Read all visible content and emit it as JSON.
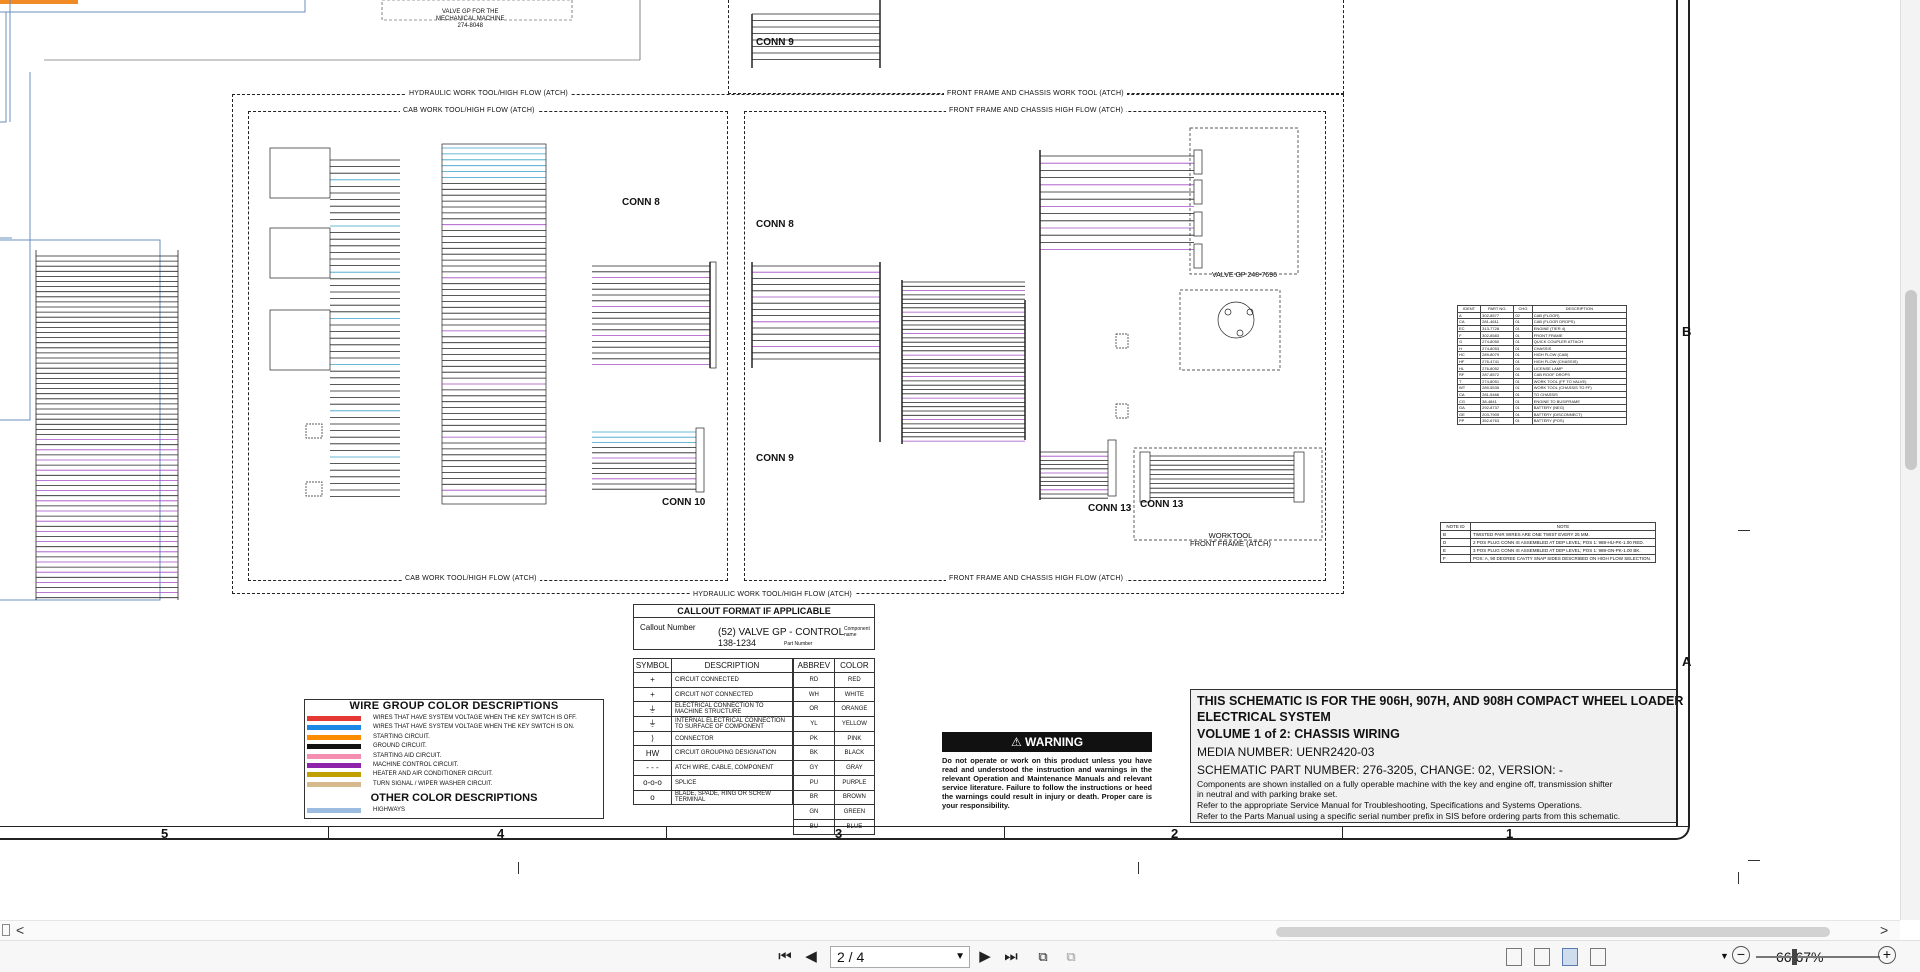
{
  "document": {
    "frames": {
      "hydraulic_top_left": "HYDRAULIC WORK TOOL/HIGH FLOW (ATCH)",
      "front_frame_work_tool": "FRONT FRAME AND CHASSIS WORK TOOL (ATCH)",
      "cab_work_tool_top": "CAB WORK TOOL/HIGH FLOW (ATCH)",
      "front_frame_high_flow_top": "FRONT FRAME AND CHASSIS HIGH FLOW (ATCH)",
      "cab_work_tool_bottom": "CAB WORK TOOL/HIGH FLOW (ATCH)",
      "front_frame_high_flow_bottom": "FRONT FRAME AND CHASSIS HIGH FLOW (ATCH)",
      "hydraulic_bottom": "HYDRAULIC WORK TOOL/HIGH FLOW (ATCH)"
    },
    "valve_top": "VALVE GP FOR THE\nMECHANICAL MACHINE\n274-8048",
    "valve_gp": "VALVE GP 248-7696",
    "connectors": {
      "conn9_top": "CONN 9",
      "conn8_left": "CONN 8",
      "conn8_right": "CONN 8",
      "conn9_bottom": "CONN 9",
      "conn10": "CONN 10",
      "conn13_a": "CONN 13",
      "conn13_b": "CONN 13"
    },
    "worktool_label": "WORKTOOL\nFRONT FRAME (ATCH)",
    "callout": {
      "title": "CALLOUT FORMAT IF APPLICABLE",
      "number_label": "Callout Number",
      "main": "(52) VALVE GP - CONTROL",
      "part_number": "138-1234",
      "component_name": "Component\nname",
      "part_number_label": "Part Number"
    },
    "symbol_table": {
      "headers": [
        "SYMBOL",
        "DESCRIPTION"
      ],
      "rows": [
        {
          "symbol": "+",
          "description": "CIRCUIT CONNECTED"
        },
        {
          "symbol": "+",
          "description": "CIRCUIT NOT CONNECTED"
        },
        {
          "symbol": "⏚",
          "description": "ELECTRICAL CONNECTION TO MACHINE STRUCTURE"
        },
        {
          "symbol": "⏚",
          "description": "INTERNAL ELECTRICAL CONNECTION TO SURFACE OF COMPONENT"
        },
        {
          "symbol": "⟩",
          "description": "CONNECTOR"
        },
        {
          "symbol": "HW",
          "description": "CIRCUIT GROUPING DESIGNATION"
        },
        {
          "symbol": "- - -",
          "description": "ATCH WIRE, CABLE, COMPONENT"
        },
        {
          "symbol": "o-o-o",
          "description": "SPLICE"
        },
        {
          "symbol": "o",
          "description": "BLADE, SPADE, RING OR SCREW TERMINAL"
        }
      ]
    },
    "color_table": {
      "headers": [
        "ABBREV",
        "COLOR"
      ],
      "rows": [
        [
          "RD",
          "RED"
        ],
        [
          "WH",
          "WHITE"
        ],
        [
          "OR",
          "ORANGE"
        ],
        [
          "YL",
          "YELLOW"
        ],
        [
          "PK",
          "PINK"
        ],
        [
          "BK",
          "BLACK"
        ],
        [
          "GY",
          "GRAY"
        ],
        [
          "PU",
          "PURPLE"
        ],
        [
          "BR",
          "BROWN"
        ],
        [
          "GN",
          "GREEN"
        ],
        [
          "BU",
          "BLUE"
        ]
      ]
    },
    "wire_group": {
      "title": "WIRE GROUP COLOR DESCRIPTIONS",
      "rows": [
        {
          "color": "#e53935",
          "text": "WIRES THAT HAVE SYSTEM VOLTAGE WHEN THE KEY SWITCH IS OFF."
        },
        {
          "color": "#1e88e5",
          "text": "WIRES THAT HAVE SYSTEM VOLTAGE WHEN THE KEY SWITCH IS ON."
        },
        {
          "color": "#fb8c00",
          "text": "STARTING CIRCUIT."
        },
        {
          "color": "#111111",
          "text": "GROUND CIRCUIT."
        },
        {
          "color": "#f48fb1",
          "text": "STARTING AID CIRCUIT."
        },
        {
          "color": "#8e24aa",
          "text": "MACHINE CONTROL CIRCUIT."
        },
        {
          "color": "#c0a000",
          "text": "HEATER AND AIR CONDITIONER CIRCUIT."
        },
        {
          "color": "#d7b98e",
          "text": "TURN SIGNAL / WIPER WASHER CIRCUIT."
        }
      ],
      "other_title": "OTHER COLOR DESCRIPTIONS",
      "other_rows": [
        {
          "color": "#9bbbe0",
          "text": "HIGHWAYS"
        }
      ]
    },
    "warning": {
      "title": "WARNING",
      "body": "Do not operate or work on this product unless you have read and understood the instruction and warnings in the relevant Operation and Maintenance Manuals and relevant service literature. Failure to follow the instructions or heed the warnings could result in injury or death. Proper care is your responsibility."
    },
    "title_block": {
      "line1": "THIS SCHEMATIC IS FOR THE 906H, 907H, AND 908H COMPACT WHEEL LOADER",
      "line2": "ELECTRICAL SYSTEM",
      "line3": "VOLUME 1 of 2: CHASSIS WIRING",
      "line4": "MEDIA NUMBER: UENR2420-03",
      "line5": "SCHEMATIC PART NUMBER: 276-3205, CHANGE: 02, VERSION: -",
      "line6": "Components are shown installed on a fully operable machine with the key and engine off, transmission shifter",
      "line7": "in neutral and with parking brake set.",
      "line8": "Refer to the appropriate Service Manual for Troubleshooting, Specifications and Systems Operations.",
      "line9": "Refer to the Parts Manual using a specific serial number prefix in SIS before ordering parts from this schematic."
    },
    "grid_columns": [
      "5",
      "4",
      "3",
      "2",
      "1"
    ],
    "grid_rows": [
      "B",
      "A"
    ],
    "parts_table": {
      "headers": [
        "IDENT",
        "PART NO.",
        "CHG",
        "DESCRIPTION"
      ],
      "rows": [
        [
          "A",
          "302-8577",
          "02",
          "CAB (FLOOR)"
        ],
        [
          "CA",
          "281-4611",
          "01",
          "CAB (FLOOR DROPS)"
        ],
        [
          "EC",
          "313-7728",
          "01",
          "ENGINE (TIER 4)"
        ],
        [
          "F",
          "302-8583",
          "01",
          "FRONT FRAME"
        ],
        [
          "G",
          "274-8050",
          "01",
          "QUICK COUPLER ATTACH"
        ],
        [
          "H",
          "274-8053",
          "01",
          "CHASSIS"
        ],
        [
          "HC",
          "289-8079",
          "01",
          "HIGH FLOW (CAB)"
        ],
        [
          "HF",
          "276-4741",
          "01",
          "HIGH FLOW (CHASSIS)"
        ],
        [
          "HL",
          "276-8052",
          "04",
          "LICENSE LAMP"
        ],
        [
          "RF",
          "287-8572",
          "01",
          "CAB ROOF DROPS"
        ],
        [
          "T",
          "274-8051",
          "01",
          "WORK TOOL (FF TO VALVE)"
        ],
        [
          "WT",
          "289-5535",
          "01",
          "WORK TOOL (CHASSIS TO FF)"
        ],
        [
          "CA",
          "281-5466",
          "01",
          "TO CHASSIS"
        ],
        [
          "CG",
          "38-4841",
          "01",
          "ENGINE TO BUS/FRAME"
        ],
        [
          "GA",
          "292-8737",
          "01",
          "BATTERY (NEG)"
        ],
        [
          "GE",
          "203-7905",
          "01",
          "BATTERY (DISCONNECT)"
        ],
        [
          "PP",
          "352-6763",
          "01",
          "BATTERY (POS)"
        ]
      ]
    },
    "note_table": {
      "headers": [
        "NOTE ID",
        "NOTE"
      ],
      "rows": [
        [
          "B",
          "TWISTED PAIR WIRES ARE ONE TWIST EVERY 25 MM."
        ],
        [
          "D",
          "2 POS PLUG CONN IS ASSEMBLED AT DEP LEVEL; POS 1: 988-HU-PK-1.00 RED."
        ],
        [
          "E",
          "3 POS PLUG CONN IS ASSEMBLED AT DEP LEVEL; POS 1: 988-GN-PK-1.00 BK."
        ],
        [
          "F",
          "POS: A, 90 DEGREE CAVITY SNAP SIDES DESCRIBED ON HIGH FLOW SELECTION."
        ]
      ]
    }
  },
  "scrollbars": {
    "h_left": "<",
    "h_right": ">"
  },
  "toolbar": {
    "page_value": "2 / 4",
    "zoom_value": "66.67%",
    "zoom_minus": "−",
    "zoom_plus": "+"
  }
}
